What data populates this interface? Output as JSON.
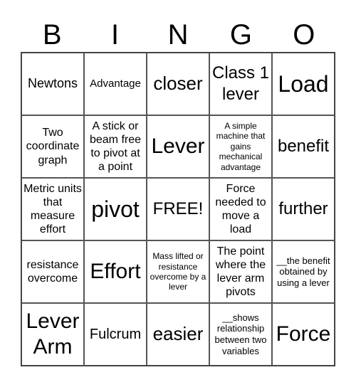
{
  "header": [
    "B",
    "I",
    "N",
    "G",
    "O"
  ],
  "cells": [
    "Newtons",
    "Advantage",
    "closer",
    "Class 1 lever",
    "Load",
    "Two coordinate graph",
    "A stick or beam free to pivot at a point",
    "Lever",
    "A simple machine that gains mechanical advantage",
    "benefit",
    "Metric units that measure effort",
    "pivot",
    "FREE!",
    "Force needed to move a load",
    "further",
    "resistance overcome",
    "Effort",
    "Mass lifted or resistance overcome by a lever",
    "The point where the lever arm pivots",
    "__the benefit obtained by using a lever",
    "Lever Arm",
    "Fulcrum",
    "easier",
    "__shows relationship between two variables",
    "Force"
  ]
}
